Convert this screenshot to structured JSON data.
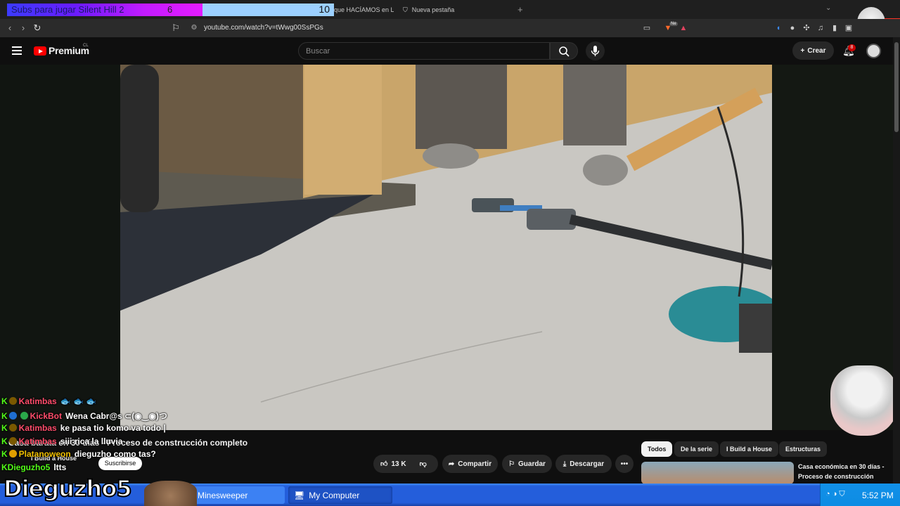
{
  "browser": {
    "subs_goal": {
      "label": "Subs para jugar Silent Hill 2",
      "current": "6",
      "goal": "10",
      "progress": 0.6
    },
    "tabs": [
      {
        "label": "que HACÍAMOS en LOS"
      },
      {
        "label": "Nueva pestaña"
      }
    ],
    "url": "youtube.com/watch?v=tWwg00SsPGs",
    "ext_badge": "Ne"
  },
  "youtube": {
    "logo_text": "Premium",
    "country": "CL",
    "search_placeholder": "Buscar",
    "create_label": "Crear",
    "notifications": "8",
    "video_title_line1": "Casa barata en 30 días - Proceso de construcción completo",
    "channel_name": "I Build a House",
    "subscribe_label": "Suscribirse",
    "likes": "13 K",
    "share": "Compartir",
    "save": "Guardar",
    "download": "Descargar",
    "chips": [
      "Todos",
      "De la serie",
      "I Build a House",
      "Estructuras"
    ],
    "rec_title": "Casa económica en 30 días - Proceso de construcción"
  },
  "chat": [
    {
      "user": "Katimbas",
      "msg": "🐟 🐟 🐟",
      "color": "red"
    },
    {
      "user": "KickBot",
      "msg": "Wena Cabr@s ⊂(◉‿◉)つ",
      "color": "red"
    },
    {
      "user": "Katimbas",
      "msg": "ke pasa tio komo va todo |",
      "color": "red"
    },
    {
      "user": "Katimbas",
      "msg": "siii rica la lluvia",
      "color": "red"
    },
    {
      "user": "Platanoweon",
      "msg": "dieguzho como tas?",
      "color": "yellow"
    },
    {
      "user": "Dieguzho5",
      "msg": "ltts",
      "color": "green"
    }
  ],
  "streamer_name": "Dieguzho5",
  "taskbar": {
    "apps": [
      "Minesweeper",
      "My Computer"
    ],
    "clock": "5:52 PM"
  }
}
